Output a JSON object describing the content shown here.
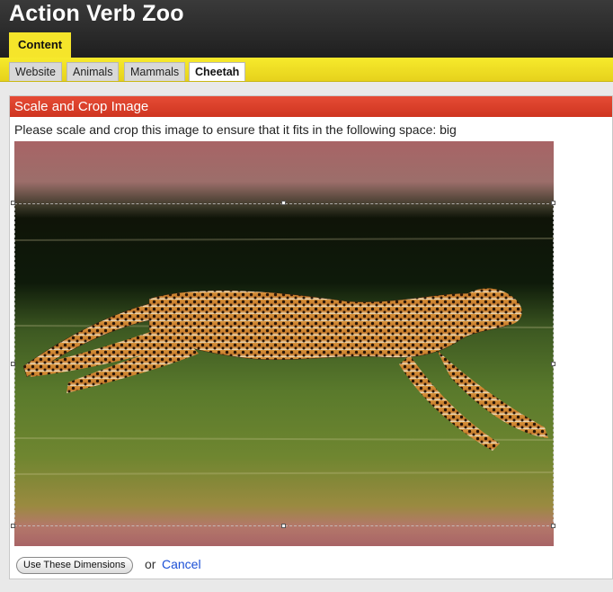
{
  "app": {
    "title": "Action Verb Zoo"
  },
  "tabs": [
    {
      "label": "Content",
      "active": true
    }
  ],
  "breadcrumb": [
    {
      "label": "Website"
    },
    {
      "label": "Animals"
    },
    {
      "label": "Mammals"
    },
    {
      "label": "Cheetah",
      "active": true
    }
  ],
  "panel": {
    "title": "Scale and Crop Image",
    "instructions": "Please scale and crop this image to ensure that it fits in the following space: big"
  },
  "actions": {
    "use_dimensions_label": "Use These Dimensions",
    "or_text": "or",
    "cancel_label": "Cancel"
  },
  "image": {
    "subject": "cheetah-running-photo"
  },
  "colors": {
    "header_bg": "#2a2a2a",
    "accent_yellow": "#f5e52a",
    "panel_title_red": "#d93a24",
    "link_blue": "#1a4fd6"
  }
}
